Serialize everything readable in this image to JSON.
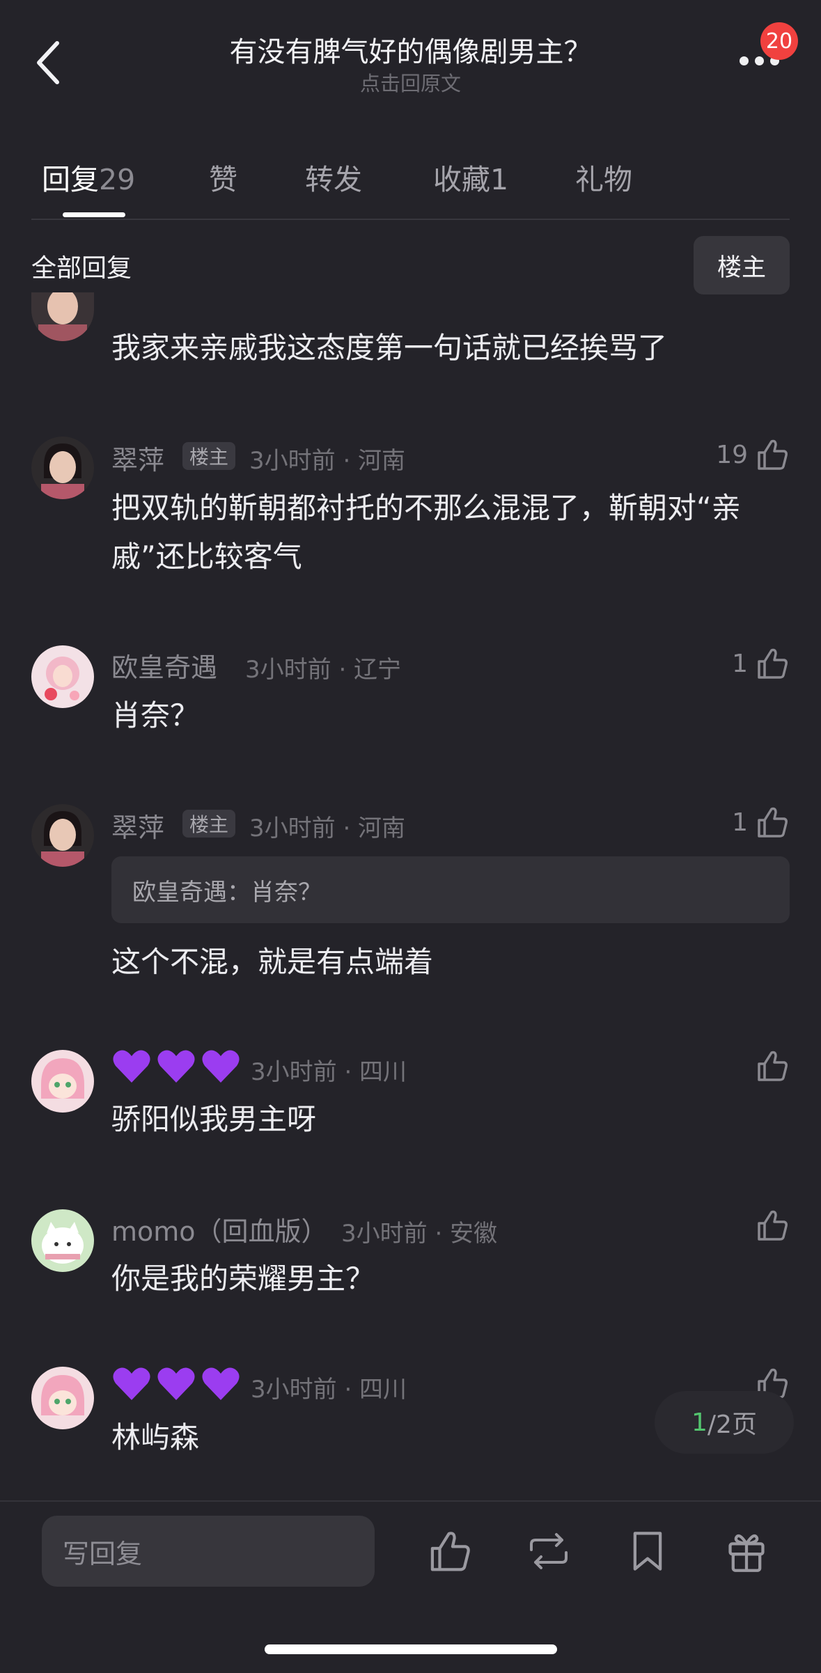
{
  "header": {
    "title": "有没有脾气好的偶像剧男主？",
    "subtitle": "点击回原文",
    "badge_count": "20",
    "back_icon": "chevron-left-icon",
    "more_icon": "more-dots-icon"
  },
  "tabs": [
    {
      "label": "回复",
      "count": "29",
      "active": true
    },
    {
      "label": "赞",
      "count": "",
      "active": false
    },
    {
      "label": "转发",
      "count": "",
      "active": false
    },
    {
      "label": "收藏",
      "count": "1",
      "active": false
    },
    {
      "label": "礼物",
      "count": "",
      "active": false
    }
  ],
  "filter": {
    "label": "全部回复",
    "op_button": "楼主"
  },
  "comments": [
    {
      "text": "我家来亲戚我这态度第一句话就已经挨骂了"
    },
    {
      "name": "翠萍",
      "op_tag": "楼主",
      "meta": "3小时前 · 河南",
      "likes": "19",
      "text": "把双轨的靳朝都衬托的不那么混混了，靳朝对“亲戚”还比较客气"
    },
    {
      "name": "欧皇奇遇",
      "meta": "3小时前 · 辽宁",
      "likes": "1",
      "text": "肖奈？"
    },
    {
      "name": "翠萍",
      "op_tag": "楼主",
      "meta": "3小时前 · 河南",
      "likes": "1",
      "quote": "欧皇奇遇：肖奈？",
      "text": "这个不混，就是有点端着"
    },
    {
      "name_emoji": "purple-hearts",
      "meta": "3小时前 · 四川",
      "likes": "",
      "text": "骄阳似我男主呀"
    },
    {
      "name": "momo（回血版）",
      "meta": "3小时前 · 安徽",
      "likes": "",
      "text": "你是我的荣耀男主？"
    },
    {
      "name_emoji": "purple-hearts",
      "meta": "3小时前 · 四川",
      "likes": "",
      "text": "林屿森"
    }
  ],
  "pagination": {
    "current": "1",
    "total_text": "/2页"
  },
  "bottom_bar": {
    "reply_placeholder": "写回复",
    "icons": [
      "thumbs-up-icon",
      "repost-icon",
      "bookmark-icon",
      "gift-icon"
    ]
  },
  "colors": {
    "background": "#242329",
    "badge": "#f0413f",
    "heart": "#9b3df0",
    "page_current": "#53c46e"
  }
}
